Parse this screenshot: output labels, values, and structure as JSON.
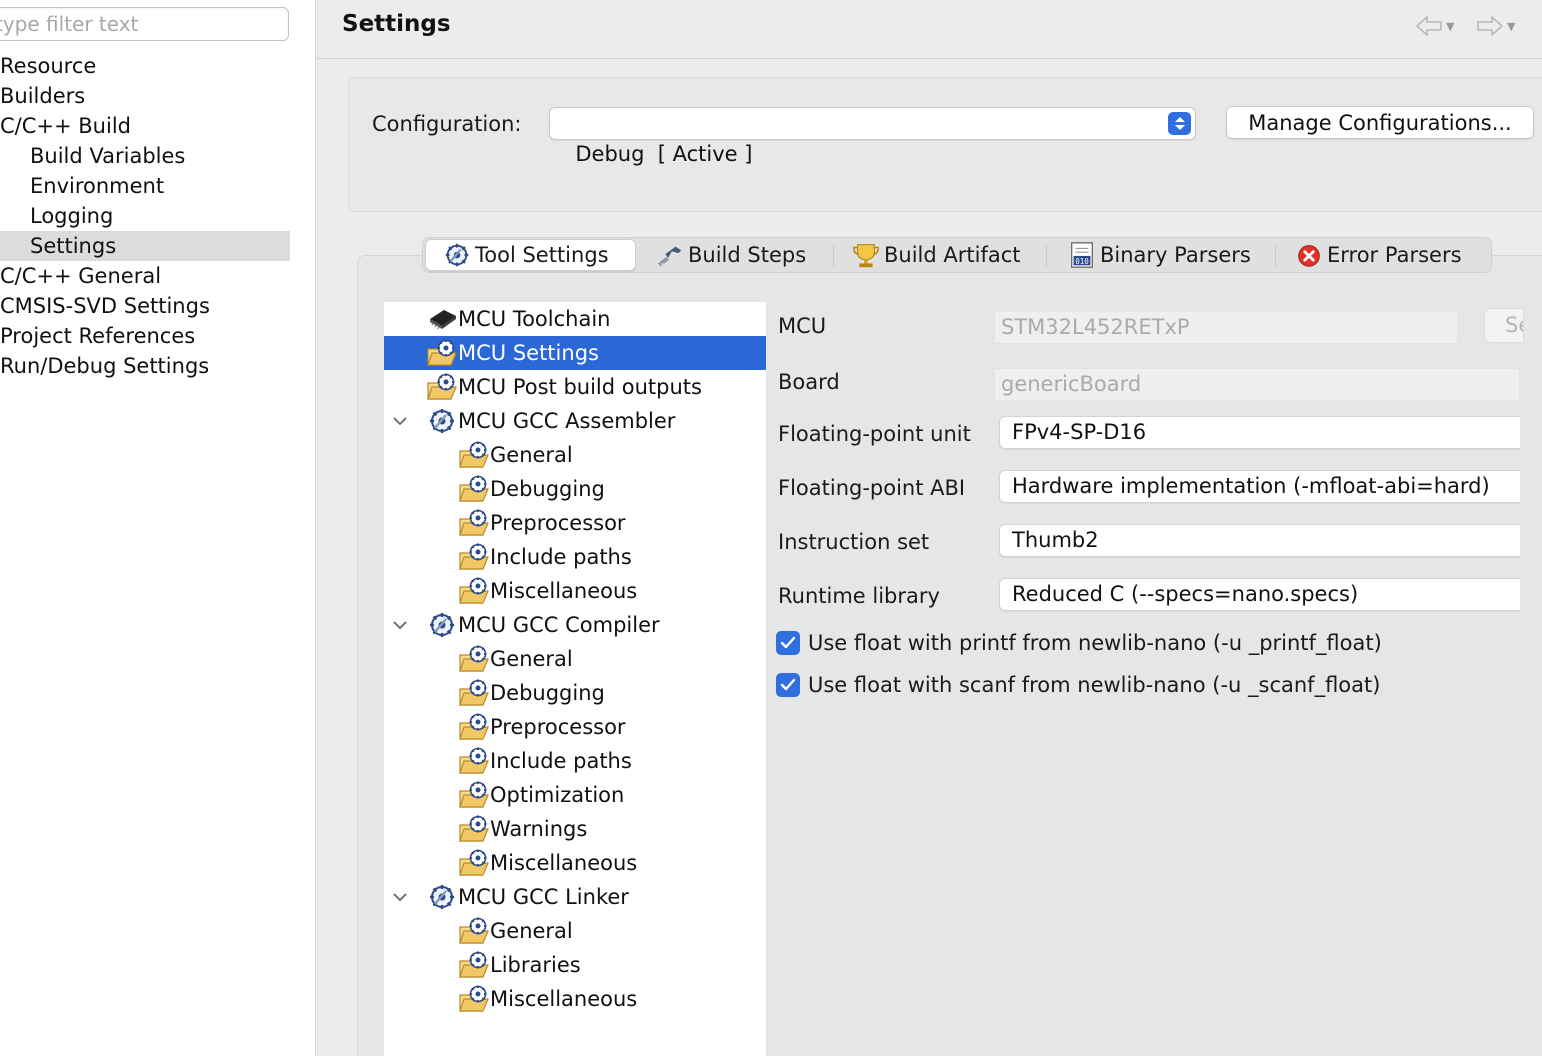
{
  "nav": {
    "filter_placeholder": "type filter text",
    "items": [
      {
        "label": "Resource"
      },
      {
        "label": "Builders"
      },
      {
        "label": "C/C++ Build"
      },
      {
        "label": "Build Variables"
      },
      {
        "label": "Environment"
      },
      {
        "label": "Logging"
      },
      {
        "label": "Settings"
      },
      {
        "label": "C/C++ General"
      },
      {
        "label": "CMSIS-SVD Settings"
      },
      {
        "label": "Project References"
      },
      {
        "label": "Run/Debug Settings"
      }
    ],
    "selected": "Settings"
  },
  "header": {
    "title": "Settings",
    "back_icon": "back-arrow-icon",
    "forward_icon": "forward-arrow-icon"
  },
  "configuration": {
    "label": "Configuration:",
    "value": "Debug  [ Active ]",
    "manage_button": "Manage Configurations..."
  },
  "tabs": [
    {
      "label": "Tool Settings",
      "icon": "tool-settings-icon",
      "active": true
    },
    {
      "label": "Build Steps",
      "icon": "build-steps-icon"
    },
    {
      "label": "Build Artifact",
      "icon": "build-artifact-icon"
    },
    {
      "label": "Binary Parsers",
      "icon": "binary-parsers-icon"
    },
    {
      "label": "Error Parsers",
      "icon": "error-parsers-icon"
    }
  ],
  "tool_tree": {
    "items": [
      {
        "label": "MCU Toolchain",
        "icon": "chip-icon"
      },
      {
        "label": "MCU Settings",
        "icon": "folder-settings-icon",
        "selected": true
      },
      {
        "label": "MCU Post build outputs",
        "icon": "folder-settings-icon"
      },
      {
        "label": "MCU GCC Assembler",
        "icon": "tool-gear-icon",
        "expanded": true
      },
      {
        "label": "General",
        "icon": "folder-settings-icon"
      },
      {
        "label": "Debugging",
        "icon": "folder-settings-icon"
      },
      {
        "label": "Preprocessor",
        "icon": "folder-settings-icon"
      },
      {
        "label": "Include paths",
        "icon": "folder-settings-icon"
      },
      {
        "label": "Miscellaneous",
        "icon": "folder-settings-icon"
      },
      {
        "label": "MCU GCC Compiler",
        "icon": "tool-gear-icon",
        "expanded": true
      },
      {
        "label": "General",
        "icon": "folder-settings-icon"
      },
      {
        "label": "Debugging",
        "icon": "folder-settings-icon"
      },
      {
        "label": "Preprocessor",
        "icon": "folder-settings-icon"
      },
      {
        "label": "Include paths",
        "icon": "folder-settings-icon"
      },
      {
        "label": "Optimization",
        "icon": "folder-settings-icon"
      },
      {
        "label": "Warnings",
        "icon": "folder-settings-icon"
      },
      {
        "label": "Miscellaneous",
        "icon": "folder-settings-icon"
      },
      {
        "label": "MCU GCC Linker",
        "icon": "tool-gear-icon",
        "expanded": true
      },
      {
        "label": "General",
        "icon": "folder-settings-icon"
      },
      {
        "label": "Libraries",
        "icon": "folder-settings-icon"
      },
      {
        "label": "Miscellaneous",
        "icon": "folder-settings-icon"
      }
    ]
  },
  "form": {
    "mcu_label": "MCU",
    "mcu_value": "STM32L452RETxP",
    "select_button": "Select...",
    "board_label": "Board",
    "board_value": "genericBoard",
    "fpu_label": "Floating-point unit",
    "fpu_value": "FPv4-SP-D16",
    "fpabi_label": "Floating-point ABI",
    "fpabi_value": "Hardware implementation (-mfloat-abi=hard)",
    "iset_label": "Instruction set",
    "iset_value": "Thumb2",
    "runtime_label": "Runtime library",
    "runtime_value": "Reduced C (--specs=nano.specs)",
    "printf_label": "Use float with printf from newlib-nano (-u _printf_float)",
    "printf_checked": true,
    "scanf_label": "Use float with scanf from newlib-nano (-u _scanf_float)",
    "scanf_checked": true
  },
  "colors": {
    "accent": "#2f6fe0",
    "selection": "#2c67d6",
    "folder": "#f2c766"
  }
}
